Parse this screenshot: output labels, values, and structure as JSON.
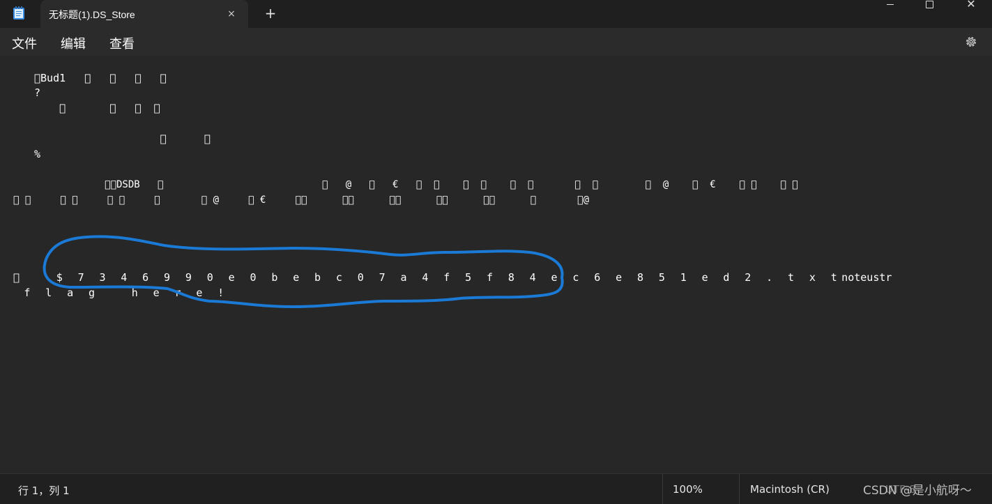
{
  "window": {
    "tab_title": "无标题(1).DS_Store",
    "tab_close_icon": "×",
    "new_tab_icon": "+",
    "close_icon": "✕"
  },
  "menu": {
    "file": "文件",
    "edit": "编辑",
    "view": "查看"
  },
  "content": {
    "lines": [
      "\u0000Bud1   \u0000   \u0000   \u0000   \u0000",
      "?",
      "    \u0000       \u0000   \u0000  \u0000",
      "",
      "                    \u0000      \u0000",
      "%",
      "",
      "            \u0000\u0000DSDB   \u0000                           \u0000   @   \u0000   €   \u0000  \u0000    \u0000  \u0000    \u0000  \u0000       \u0000  \u0000        \u0000  @    \u0000  €    \u0000 \u0000    \u0000 \u0000",
      "\u0000 \u0000     \u0000 \u0000     \u0000 \u0000     \u0000       \u0000 @     \u0000 €     \u0000\u0000      \u0000\u0000      \u0000\u0000      \u0000\u0000      \u0000\u0000      \u0000       \u0000@",
      "",
      "",
      "",
      "\u0000   $ 7 3 4 6 9 9 0 e 0 b e b c 0 7 a 4 f 5 f 8 4 e c 6 e 8 5 1 e d 2 . t x t",
      " f l a g   h e r e !"
    ],
    "line13_suffix": "noteustr"
  },
  "status": {
    "position": "行 1，列 1",
    "zoom": "100%",
    "line_ending": "Macintosh (CR)",
    "encoding": "UTF-8"
  },
  "watermark": "CSDN @是小航呀～",
  "colors": {
    "background": "#272727",
    "annotation": "#1a7ad6"
  }
}
